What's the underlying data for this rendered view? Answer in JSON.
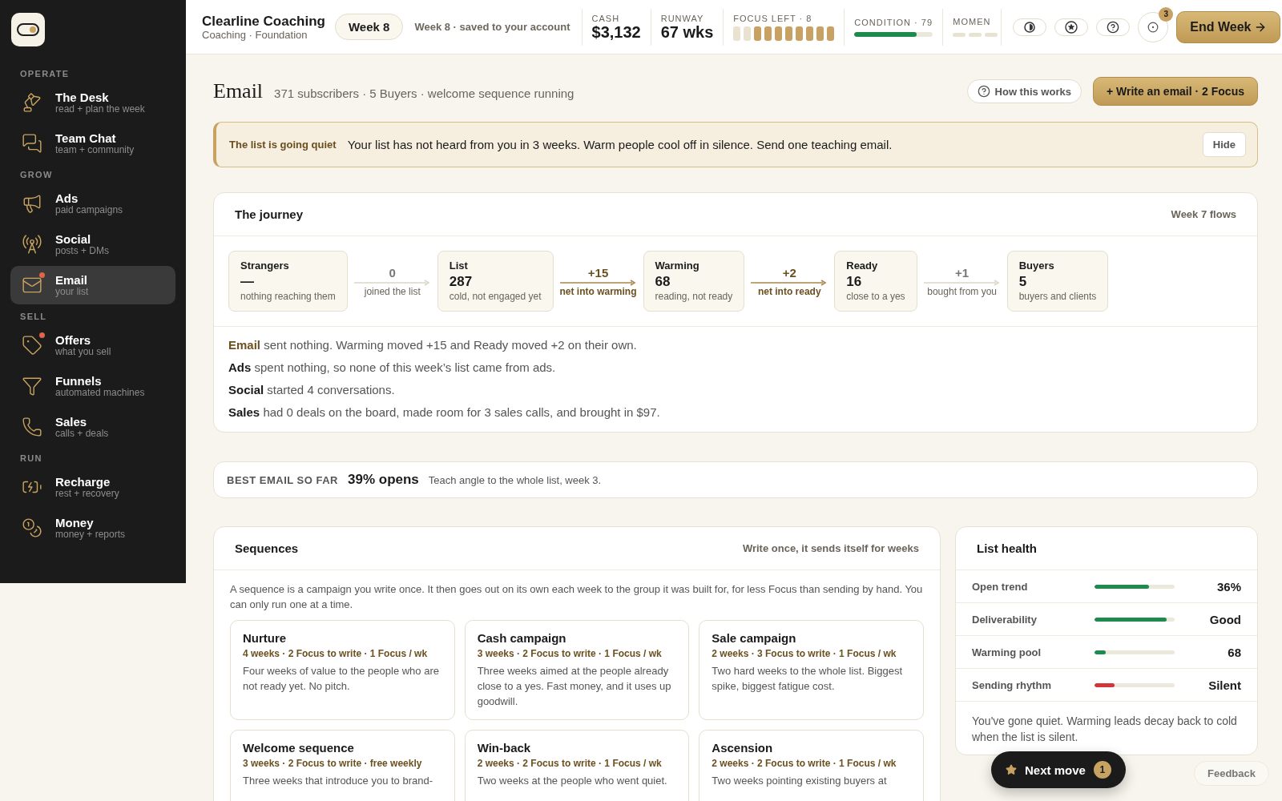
{
  "sidebar": {
    "sections": [
      {
        "title": "OPERATE",
        "items": [
          {
            "label": "The Desk",
            "sub": "read + plan the week",
            "selected": false,
            "alert": false
          },
          {
            "label": "Team Chat",
            "sub": "team + community",
            "selected": false,
            "alert": false
          }
        ]
      },
      {
        "title": "GROW",
        "items": [
          {
            "label": "Ads",
            "sub": "paid campaigns",
            "selected": false,
            "alert": false
          },
          {
            "label": "Social",
            "sub": "posts + DMs",
            "selected": false,
            "alert": false
          },
          {
            "label": "Email",
            "sub": "your list",
            "selected": true,
            "alert": true
          }
        ]
      },
      {
        "title": "SELL",
        "items": [
          {
            "label": "Offers",
            "sub": "what you sell",
            "selected": false,
            "alert": true
          },
          {
            "label": "Funnels",
            "sub": "automated machines",
            "selected": false,
            "alert": false
          },
          {
            "label": "Sales",
            "sub": "calls + deals",
            "selected": false,
            "alert": false
          }
        ]
      },
      {
        "title": "RUN",
        "items": [
          {
            "label": "Recharge",
            "sub": "rest + recovery",
            "selected": false,
            "alert": false
          },
          {
            "label": "Money",
            "sub": "money + reports",
            "selected": false,
            "alert": false
          }
        ]
      }
    ]
  },
  "topbar": {
    "business": "Clearline Coaching",
    "subtitle": "Coaching · Foundation",
    "week": "Week 8",
    "saved": "Week 8 · saved to your account",
    "cash": {
      "label": "CASH",
      "value": "$3,132"
    },
    "runway": {
      "label": "RUNWAY",
      "value": "67 wks"
    },
    "focus": {
      "label": "FOCUS LEFT · 8",
      "pips": [
        {
          "filled": false
        },
        {
          "filled": false
        },
        {
          "filled": true
        },
        {
          "filled": true
        },
        {
          "filled": true
        },
        {
          "filled": true
        },
        {
          "filled": true
        },
        {
          "filled": true
        },
        {
          "filled": true
        },
        {
          "filled": true
        }
      ]
    },
    "condition": {
      "label": "CONDITION · 79",
      "level": 0.79
    },
    "momentum": {
      "label": "MOMEN"
    },
    "tools": [
      {
        "kind": "half"
      },
      {
        "kind": "star"
      },
      {
        "kind": "help"
      }
    ],
    "notifications": {
      "count": "3"
    },
    "end_week": "End Week"
  },
  "page": {
    "title": "Email",
    "summary": "371 subscribers · 5 Buyers · welcome sequence running",
    "help": "How this works",
    "write": "+ Write an email · 2 Focus"
  },
  "banner": {
    "title": "The list is going quiet",
    "text": "Your list has not heard from you in 3 weeks. Warm people cool off in silence. Send one teaching email.",
    "action": "Hide"
  },
  "journey": {
    "title": "The journey",
    "note": "Week 7 flows",
    "steps": [
      {
        "kind": "stage",
        "name": "Strangers",
        "value": "—",
        "caption": "nothing reaching them"
      },
      {
        "kind": "flow",
        "value": "0",
        "caption": "joined the list",
        "active": false
      },
      {
        "kind": "stage",
        "name": "List",
        "value": "287",
        "caption": "cold, not engaged yet"
      },
      {
        "kind": "flow",
        "value": "+15",
        "caption": "net into warming",
        "active": true
      },
      {
        "kind": "stage",
        "name": "Warming",
        "value": "68",
        "caption": "reading, not ready"
      },
      {
        "kind": "flow",
        "value": "+2",
        "caption": "net into ready",
        "active": true
      },
      {
        "kind": "stage",
        "name": "Ready",
        "value": "16",
        "caption": "close to a yes"
      },
      {
        "kind": "flow",
        "value": "+1",
        "caption": "bought from you",
        "active": false
      },
      {
        "kind": "stage",
        "name": "Buyers",
        "value": "5",
        "caption": "buyers and clients"
      }
    ],
    "lines": [
      {
        "lead": "Email",
        "text": "sent nothing. Warming moved +15 and Ready moved +2 on their own.",
        "highlight": true
      },
      {
        "lead": "Ads",
        "text": "spent nothing, so none of this week’s list came from ads.",
        "highlight": false
      },
      {
        "lead": "Social",
        "text": "started 4 conversations.",
        "highlight": false
      },
      {
        "lead": "Sales",
        "text": "had 0 deals on the board, made room for 3 sales calls, and brought in $97.",
        "highlight": false
      }
    ]
  },
  "best_email": {
    "label": "BEST EMAIL SO FAR",
    "value": "39% opens",
    "text": "Teach angle to the whole list, week 3."
  },
  "sequences": {
    "title": "Sequences",
    "note": "Write once, it sends itself for weeks",
    "intro": "A sequence is a campaign you write once. It then goes out on its own each week to the group it was built for, for less Focus than sending by hand. You can only run one at a time.",
    "cards": [
      {
        "name": "Nurture",
        "meta": "4 weeks · 2 Focus to write · 1 Focus / wk",
        "text": "Four weeks of value to the people who are not ready yet. No pitch."
      },
      {
        "name": "Cash campaign",
        "meta": "3 weeks · 2 Focus to write · 1 Focus / wk",
        "text": "Three weeks aimed at the people already close to a yes. Fast money, and it uses up goodwill."
      },
      {
        "name": "Sale campaign",
        "meta": "2 weeks · 3 Focus to write · 1 Focus / wk",
        "text": "Two hard weeks to the whole list. Biggest spike, biggest fatigue cost."
      },
      {
        "name": "Welcome sequence",
        "meta": "3 weeks · 2 Focus to write · free weekly",
        "text": "Three weeks that introduce you to brand-"
      },
      {
        "name": "Win-back",
        "meta": "2 weeks · 2 Focus to write · 1 Focus / wk",
        "text": "Two weeks at the people who went quiet."
      },
      {
        "name": "Ascension",
        "meta": "2 weeks · 2 Focus to write · 1 Focus / wk",
        "text": "Two weeks pointing existing buyers at"
      }
    ]
  },
  "list_health": {
    "title": "List health",
    "rows": [
      {
        "label": "Open trend",
        "level": 0.68,
        "value": "36%",
        "color": "#1f8a4d"
      },
      {
        "label": "Deliverability",
        "level": 0.9,
        "value": "Good",
        "color": "#1f8a4d"
      },
      {
        "label": "Warming pool",
        "level": 0.14,
        "value": "68",
        "color": "#1f8a4d"
      },
      {
        "label": "Sending rhythm",
        "level": 0.25,
        "value": "Silent",
        "color": "#d0363a"
      }
    ],
    "note": "You've gone quiet. Warming leads decay back to cold when the list is silent."
  },
  "next_move": {
    "label": "Next move",
    "count": "1"
  },
  "feedback": "Feedback"
}
